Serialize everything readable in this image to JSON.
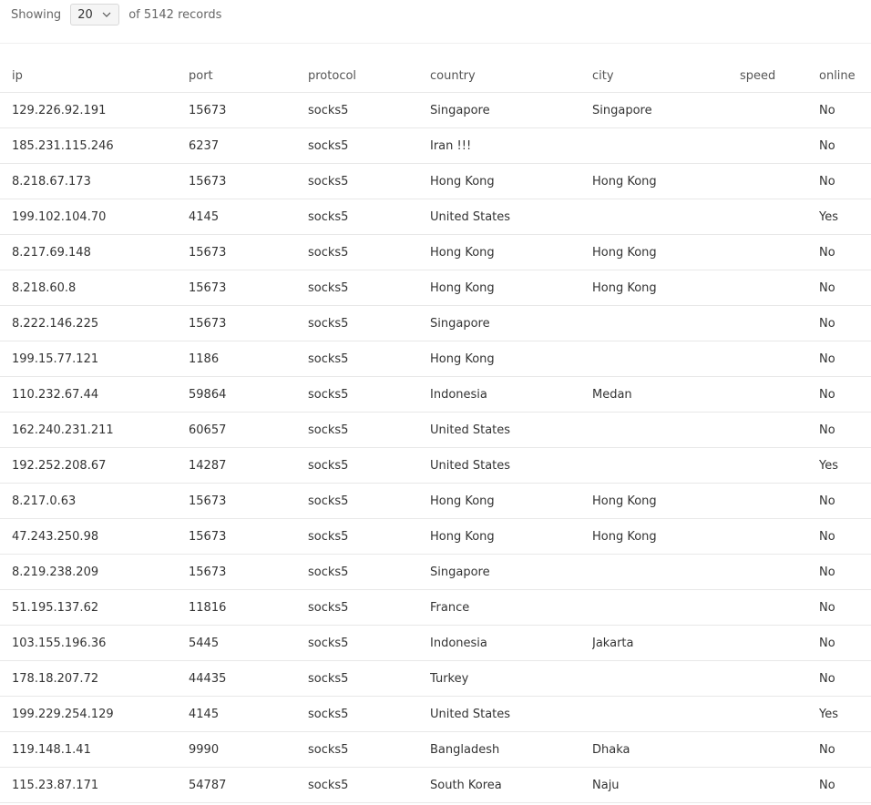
{
  "pagination": {
    "showing_label": "Showing",
    "page_size": "20",
    "total_label": "of 5142 records"
  },
  "table": {
    "columns": [
      "ip",
      "port",
      "protocol",
      "country",
      "city",
      "speed",
      "online"
    ],
    "rows": [
      {
        "ip": "129.226.92.191",
        "port": "15673",
        "protocol": "socks5",
        "country": "Singapore",
        "city": "Singapore",
        "speed": "",
        "online": "No"
      },
      {
        "ip": "185.231.115.246",
        "port": "6237",
        "protocol": "socks5",
        "country": "Iran !!!",
        "city": "",
        "speed": "",
        "online": "No"
      },
      {
        "ip": "8.218.67.173",
        "port": "15673",
        "protocol": "socks5",
        "country": "Hong Kong",
        "city": "Hong Kong",
        "speed": "",
        "online": "No"
      },
      {
        "ip": "199.102.104.70",
        "port": "4145",
        "protocol": "socks5",
        "country": "United States",
        "city": "",
        "speed": "",
        "online": "Yes"
      },
      {
        "ip": "8.217.69.148",
        "port": "15673",
        "protocol": "socks5",
        "country": "Hong Kong",
        "city": "Hong Kong",
        "speed": "",
        "online": "No"
      },
      {
        "ip": "8.218.60.8",
        "port": "15673",
        "protocol": "socks5",
        "country": "Hong Kong",
        "city": "Hong Kong",
        "speed": "",
        "online": "No"
      },
      {
        "ip": "8.222.146.225",
        "port": "15673",
        "protocol": "socks5",
        "country": "Singapore",
        "city": "",
        "speed": "",
        "online": "No"
      },
      {
        "ip": "199.15.77.121",
        "port": "1186",
        "protocol": "socks5",
        "country": "Hong Kong",
        "city": "",
        "speed": "",
        "online": "No"
      },
      {
        "ip": "110.232.67.44",
        "port": "59864",
        "protocol": "socks5",
        "country": "Indonesia",
        "city": "Medan",
        "speed": "",
        "online": "No"
      },
      {
        "ip": "162.240.231.211",
        "port": "60657",
        "protocol": "socks5",
        "country": "United States",
        "city": "",
        "speed": "",
        "online": "No"
      },
      {
        "ip": "192.252.208.67",
        "port": "14287",
        "protocol": "socks5",
        "country": "United States",
        "city": "",
        "speed": "",
        "online": "Yes"
      },
      {
        "ip": "8.217.0.63",
        "port": "15673",
        "protocol": "socks5",
        "country": "Hong Kong",
        "city": "Hong Kong",
        "speed": "",
        "online": "No"
      },
      {
        "ip": "47.243.250.98",
        "port": "15673",
        "protocol": "socks5",
        "country": "Hong Kong",
        "city": "Hong Kong",
        "speed": "",
        "online": "No"
      },
      {
        "ip": "8.219.238.209",
        "port": "15673",
        "protocol": "socks5",
        "country": "Singapore",
        "city": "",
        "speed": "",
        "online": "No"
      },
      {
        "ip": "51.195.137.62",
        "port": "11816",
        "protocol": "socks5",
        "country": "France",
        "city": "",
        "speed": "",
        "online": "No"
      },
      {
        "ip": "103.155.196.36",
        "port": "5445",
        "protocol": "socks5",
        "country": "Indonesia",
        "city": "Jakarta",
        "speed": "",
        "online": "No"
      },
      {
        "ip": "178.18.207.72",
        "port": "44435",
        "protocol": "socks5",
        "country": "Turkey",
        "city": "",
        "speed": "",
        "online": "No"
      },
      {
        "ip": "199.229.254.129",
        "port": "4145",
        "protocol": "socks5",
        "country": "United States",
        "city": "",
        "speed": "",
        "online": "Yes"
      },
      {
        "ip": "119.148.1.41",
        "port": "9990",
        "protocol": "socks5",
        "country": "Bangladesh",
        "city": "Dhaka",
        "speed": "",
        "online": "No"
      },
      {
        "ip": "115.23.87.171",
        "port": "54787",
        "protocol": "socks5",
        "country": "South Korea",
        "city": "Naju",
        "speed": "",
        "online": "No"
      }
    ]
  },
  "icons": {
    "page_size_dropdown": "chevron-down-icon"
  }
}
